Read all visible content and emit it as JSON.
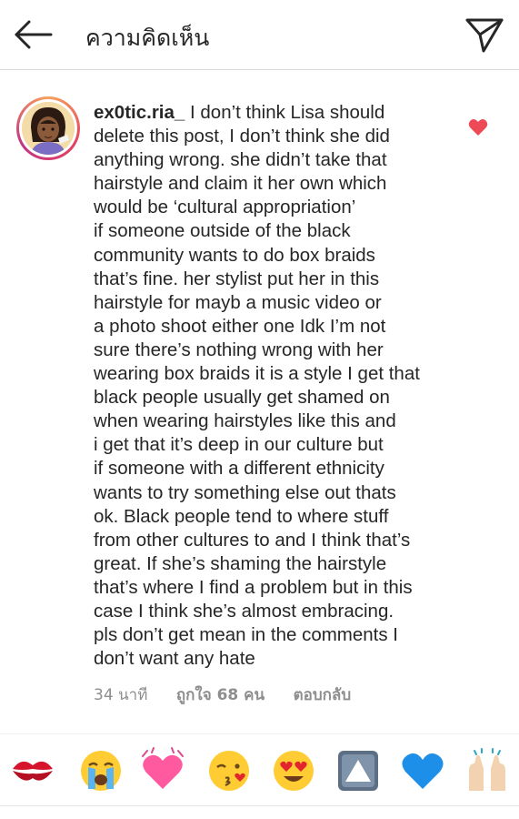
{
  "header": {
    "title": "ความคิดเห็น",
    "back_icon": "back-arrow-icon",
    "send_icon": "send-paper-plane-icon"
  },
  "comment": {
    "username": "ex0tic.ria_",
    "lines": [
      " I don’t think Lisa should",
      "delete this post, I don’t  think she did",
      "anything wrong. she didn’t take that",
      "hairstyle and claim it her own which",
      "would be ‘cultural appropriation’",
      "if someone outside of the black",
      "community wants to do box braids",
      "that’s fine. her stylist put her in this",
      "hairstyle for mayb a music video or",
      "a photo shoot either one Idk I’m not",
      "sure there’s nothing wrong with her",
      "wearing box braids it is a style I get that",
      "black people usually get shamed on",
      "when wearing hairstyles like this  and",
      "i get that it’s deep in our culture but",
      "if someone with a different ethnicity",
      "wants to try something else out thats",
      "ok. Black people tend to where stuff",
      "from other cultures to and I think that’s",
      "great. If she’s shaming the hairstyle",
      "that’s where I find a problem but in this",
      "case I think she’s almost embracing.",
      "pls don’t get mean in the comments I",
      "don’t want any hate"
    ],
    "time": "34 นาที",
    "likes": "ถูกใจ 68 คน",
    "reply": "ตอบกลับ",
    "liked": true,
    "heart_color": "#ed4956"
  },
  "emoji_bar": [
    {
      "name": "kiss-mark-emoji",
      "char": "💋"
    },
    {
      "name": "loudly-crying-face-emoji",
      "char": "😭"
    },
    {
      "name": "beating-heart-emoji",
      "char": "💓"
    },
    {
      "name": "face-blowing-kiss-emoji",
      "char": "😘"
    },
    {
      "name": "heart-eyes-emoji",
      "char": "😍"
    },
    {
      "name": "up-button-emoji",
      "char": "🔼"
    },
    {
      "name": "blue-heart-emoji",
      "char": "💙"
    },
    {
      "name": "raising-hands-emoji",
      "char": "🙌"
    }
  ],
  "colors": {
    "text": "#262626",
    "muted": "#8e8e8e",
    "like_red": "#ed4956"
  }
}
